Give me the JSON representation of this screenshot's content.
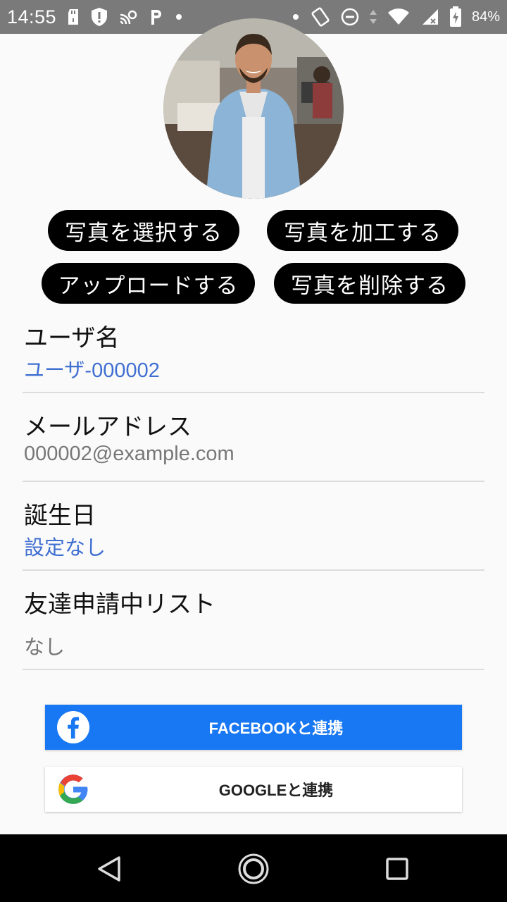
{
  "status_bar": {
    "time": "14:55",
    "battery": "84%",
    "icons": [
      "sd-card-icon",
      "shield-alert-icon",
      "cast-icon",
      "parking-icon",
      "dot-icon",
      "vibrate-icon",
      "do-not-disturb-icon",
      "data-arrows-icon",
      "wifi-icon",
      "signal-icon",
      "battery-charging-icon"
    ]
  },
  "profile": {
    "photo_buttons": {
      "select": "写真を選択する",
      "edit": "写真を加工する",
      "upload": "アップロードする",
      "delete": "写真を削除する"
    },
    "fields": {
      "username_label": "ユーザ名",
      "username_value": "ユーザ-000002",
      "email_label": "メールアドレス",
      "email_value": "000002@example.com",
      "birthday_label": "誕生日",
      "birthday_value": "設定なし",
      "friend_requests_label": "友達申請中リスト",
      "friend_requests_value": "なし"
    }
  },
  "social": {
    "facebook_label": "FACEBOOKと連携",
    "google_label": "GOOGLEと連携"
  },
  "colors": {
    "link": "#3f6fd1",
    "facebook": "#1877f2",
    "pill": "#000000"
  }
}
